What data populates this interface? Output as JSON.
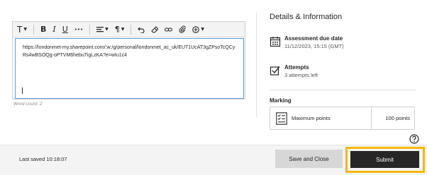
{
  "editor": {
    "toolbar": {
      "text_style_glyph": "T",
      "bold_glyph": "B",
      "italic_glyph": "I",
      "underline_glyph": "U",
      "more_glyph": "•••",
      "paragraph_glyph": "¶"
    },
    "content": "https://londonmet-my.sharepoint.com/:w:/g/personal/londonmet_ac_uk/EUT1UcAT3gZPsoTcQCyRs4wBSOQg-oPTVM6hebuTigLzKA?e=wIu1c4",
    "word_count": "Word count: 2"
  },
  "panel": {
    "title": "Details & Information",
    "due": {
      "label": "Assessment due date",
      "value": "11/12/2023, 15:15 (GMT)"
    },
    "attempts": {
      "label": "Attempts",
      "value": "3 attempts left"
    },
    "marking": {
      "label": "Marking",
      "points_label": "Maximum points",
      "points_value": "100 points"
    }
  },
  "footer": {
    "last_saved": "Last saved 10:18:07",
    "save_close_label": "Save and Close",
    "submit_label": "Submit"
  },
  "colors": {
    "submit_bg": "#262626",
    "highlight": "#f5b80a",
    "editor_focus": "#5b9bd5"
  }
}
